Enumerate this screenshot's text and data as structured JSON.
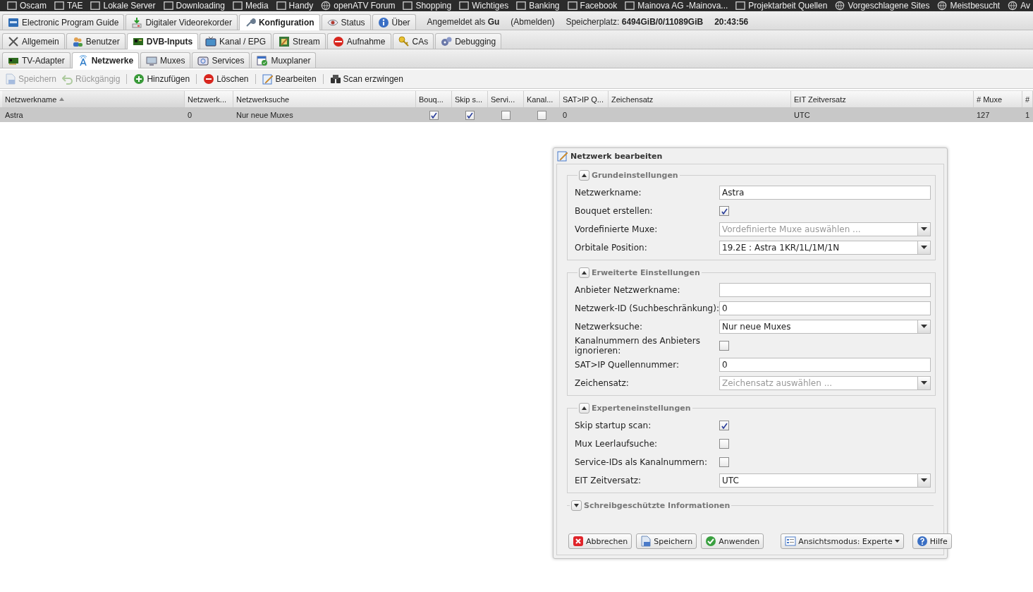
{
  "bookmarks": [
    {
      "label": "Oscam"
    },
    {
      "label": "TAE"
    },
    {
      "label": "Lokale Server"
    },
    {
      "label": "Downloading"
    },
    {
      "label": "Media"
    },
    {
      "label": "Handy"
    },
    {
      "label": "openATV Forum"
    },
    {
      "label": "Shopping"
    },
    {
      "label": "Wichtiges"
    },
    {
      "label": "Banking"
    },
    {
      "label": "Facebook"
    },
    {
      "label": "Mainova AG -Mainova..."
    },
    {
      "label": "Projektarbeit Quellen"
    },
    {
      "label": "Vorgeschlagene Sites"
    },
    {
      "label": "Meistbesucht"
    },
    {
      "label": "Av"
    }
  ],
  "main_tabs": [
    {
      "label": "Electronic Program Guide",
      "selected": false
    },
    {
      "label": "Digitaler Videorekorder",
      "selected": false
    },
    {
      "label": "Konfiguration",
      "selected": true
    },
    {
      "label": "Status",
      "selected": false
    },
    {
      "label": "Über",
      "selected": false
    }
  ],
  "session": {
    "login": "Angemeldet als **Gu**",
    "logout": "(Abmelden)",
    "storage": "Speicherplatz: **6494GiB/0/11089GiB**",
    "time": "20:43:56"
  },
  "config_tabs": [
    {
      "label": "Allgemein",
      "selected": false
    },
    {
      "label": "Benutzer",
      "selected": false
    },
    {
      "label": "DVB-Inputs",
      "selected": true
    },
    {
      "label": "Kanal / EPG",
      "selected": false
    },
    {
      "label": "Stream",
      "selected": false
    },
    {
      "label": "Aufnahme",
      "selected": false
    },
    {
      "label": "CAs",
      "selected": false
    },
    {
      "label": "Debugging",
      "selected": false
    }
  ],
  "dvb_tabs": [
    {
      "label": "TV-Adapter",
      "selected": false
    },
    {
      "label": "Netzwerke",
      "selected": true
    },
    {
      "label": "Muxes",
      "selected": false
    },
    {
      "label": "Services",
      "selected": false
    },
    {
      "label": "Muxplaner",
      "selected": false
    }
  ],
  "toolbar": [
    {
      "label": "Speichern",
      "disabled": true
    },
    {
      "label": "Rückgängig",
      "disabled": true
    },
    {
      "label": "Hinzufügen",
      "disabled": false
    },
    {
      "label": "Löschen",
      "disabled": false
    },
    {
      "label": "Bearbeiten",
      "disabled": false
    },
    {
      "label": "Scan erzwingen",
      "disabled": false
    }
  ],
  "table": {
    "columns": [
      {
        "label": "Netzwerkname",
        "sorted": true
      },
      {
        "label": "Netzwerk...",
        "sorted": false
      },
      {
        "label": "Netzwerksuche",
        "sorted": false
      },
      {
        "label": "Bouq...",
        "sorted": false
      },
      {
        "label": "Skip s...",
        "sorted": false
      },
      {
        "label": "Servi...",
        "sorted": false
      },
      {
        "label": "Kanal...",
        "sorted": false
      },
      {
        "label": "SAT>IP Q...",
        "sorted": false
      },
      {
        "label": "Zeichensatz",
        "sorted": false
      },
      {
        "label": "EIT Zeitversatz",
        "sorted": false
      },
      {
        "label": "# Muxe",
        "sorted": false
      },
      {
        "label": "#",
        "sorted": false
      }
    ],
    "rows": [
      {
        "selected": true,
        "cells": [
          {
            "kind": "text",
            "text": "Astra"
          },
          {
            "kind": "text",
            "text": "0"
          },
          {
            "kind": "text",
            "text": "Nur neue Muxes"
          },
          {
            "kind": "check",
            "checked": true
          },
          {
            "kind": "check",
            "checked": true
          },
          {
            "kind": "check",
            "checked": false
          },
          {
            "kind": "check",
            "checked": false
          },
          {
            "kind": "text",
            "text": "0"
          },
          {
            "kind": "empty"
          },
          {
            "kind": "text",
            "text": "UTC"
          },
          {
            "kind": "text",
            "text": "127"
          },
          {
            "kind": "text",
            "text": "1"
          }
        ]
      }
    ]
  },
  "dialog": {
    "title": "Netzwerk bearbeiten",
    "sections": [
      {
        "title": "Grundeinstellungen",
        "expanded": true,
        "fields": [
          {
            "kind": "text",
            "label": "Netzwerkname:",
            "value": "Astra"
          },
          {
            "kind": "check",
            "label": "Bouquet erstellen:",
            "checked": true
          },
          {
            "kind": "select",
            "label": "Vordefinierte Muxe:",
            "placeholder": "Vordefinierte Muxe auswählen ..."
          },
          {
            "kind": "select",
            "label": "Orbitale Position:",
            "value": "19.2E : Astra 1KR/1L/1M/1N"
          }
        ]
      },
      {
        "title": "Erweiterte Einstellungen",
        "expanded": true,
        "fields": [
          {
            "kind": "text",
            "label": "Anbieter Netzwerkname:"
          },
          {
            "kind": "text",
            "label": "Netzwerk-ID (Suchbeschränkung):",
            "value": "0"
          },
          {
            "kind": "select",
            "label": "Netzwerksuche:",
            "value": "Nur neue Muxes"
          },
          {
            "kind": "check",
            "label": "Kanalnummern des Anbieters ignorieren:",
            "checked": false
          },
          {
            "kind": "text",
            "label": "SAT>IP Quellennummer:",
            "value": "0"
          },
          {
            "kind": "select",
            "label": "Zeichensatz:",
            "placeholder": "Zeichensatz auswählen ..."
          }
        ]
      },
      {
        "title": "Experteneinstellungen",
        "expanded": true,
        "fields": [
          {
            "kind": "check",
            "label": "Skip startup scan:",
            "checked": true
          },
          {
            "kind": "check",
            "label": "Mux Leerlaufsuche:",
            "checked": false
          },
          {
            "kind": "check",
            "label": "Service-IDs als Kanalnummern:",
            "checked": false
          },
          {
            "kind": "select",
            "label": "EIT Zeitversatz:",
            "value": "UTC"
          }
        ]
      },
      {
        "title": "Schreibgeschützte Informationen",
        "expanded": false
      }
    ],
    "buttons": [
      {
        "label": "Abbrechen",
        "kind": "cancel"
      },
      {
        "label": "Speichern",
        "kind": "save"
      },
      {
        "label": "Anwenden",
        "kind": "apply"
      },
      {
        "label": "Ansichtsmodus: Experte",
        "kind": "menu"
      },
      {
        "label": "Hilfe",
        "kind": "help"
      }
    ]
  }
}
